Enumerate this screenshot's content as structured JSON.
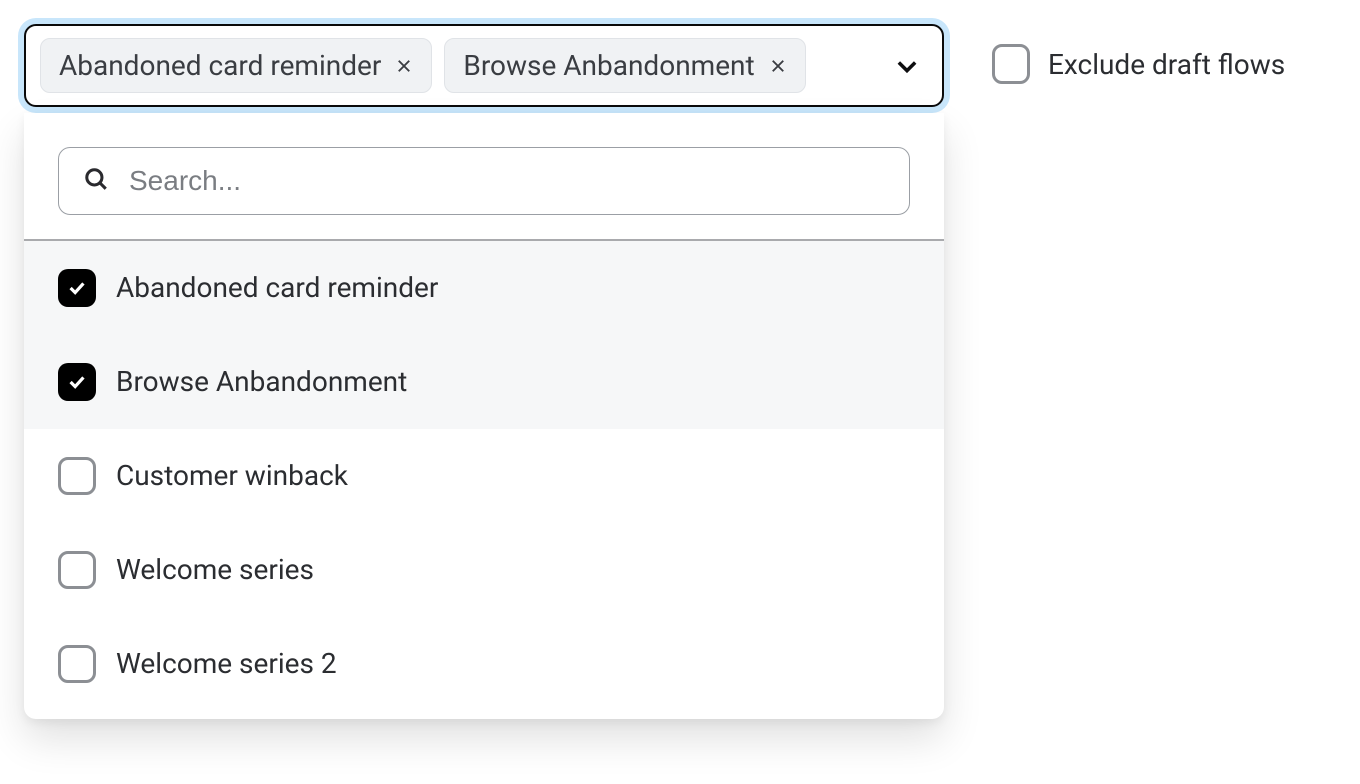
{
  "multi": {
    "tags": [
      "Abandoned card reminder",
      "Browse Anbandonment"
    ]
  },
  "search": {
    "placeholder": "Search..."
  },
  "options": [
    {
      "label": "Abandoned card reminder",
      "checked": true
    },
    {
      "label": "Browse Anbandonment",
      "checked": true
    },
    {
      "label": "Customer winback",
      "checked": false
    },
    {
      "label": "Welcome series",
      "checked": false
    },
    {
      "label": "Welcome series 2",
      "checked": false
    }
  ],
  "exclude": {
    "label": "Exclude draft flows",
    "checked": false
  }
}
